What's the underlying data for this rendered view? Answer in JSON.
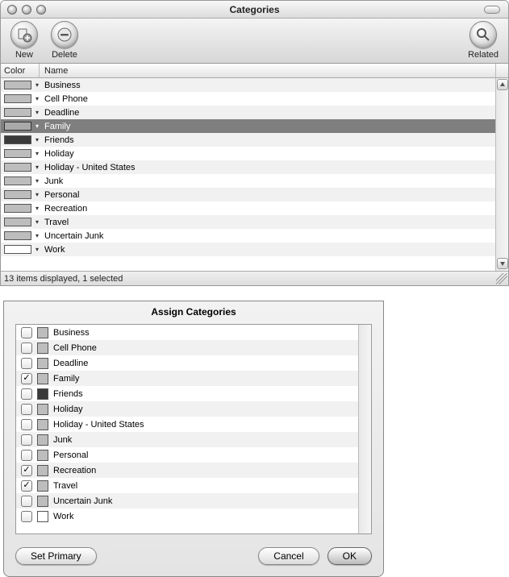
{
  "window": {
    "title": "Categories",
    "toolbar": {
      "new_label": "New",
      "delete_label": "Delete",
      "related_label": "Related"
    },
    "columns": {
      "color": "Color",
      "name": "Name"
    },
    "status": "13 items displayed, 1 selected",
    "categories": [
      {
        "name": "Business",
        "swatch": "mid",
        "selected": false
      },
      {
        "name": "Cell Phone",
        "swatch": "mid",
        "selected": false
      },
      {
        "name": "Deadline",
        "swatch": "mid",
        "selected": false
      },
      {
        "name": "Family",
        "swatch": "mid",
        "selected": true
      },
      {
        "name": "Friends",
        "swatch": "dark",
        "selected": false
      },
      {
        "name": "Holiday",
        "swatch": "mid",
        "selected": false
      },
      {
        "name": "Holiday - United States",
        "swatch": "mid",
        "selected": false
      },
      {
        "name": "Junk",
        "swatch": "mid",
        "selected": false
      },
      {
        "name": "Personal",
        "swatch": "mid",
        "selected": false
      },
      {
        "name": "Recreation",
        "swatch": "mid",
        "selected": false
      },
      {
        "name": "Travel",
        "swatch": "mid",
        "selected": false
      },
      {
        "name": "Uncertain Junk",
        "swatch": "mid",
        "selected": false
      },
      {
        "name": "Work",
        "swatch": "outline",
        "selected": false
      }
    ]
  },
  "dialog": {
    "title": "Assign Categories",
    "set_primary_label": "Set Primary",
    "cancel_label": "Cancel",
    "ok_label": "OK",
    "items": [
      {
        "name": "Business",
        "swatch": "mid",
        "checked": false
      },
      {
        "name": "Cell Phone",
        "swatch": "mid",
        "checked": false
      },
      {
        "name": "Deadline",
        "swatch": "mid",
        "checked": false
      },
      {
        "name": "Family",
        "swatch": "mid",
        "checked": true
      },
      {
        "name": "Friends",
        "swatch": "dark",
        "checked": false
      },
      {
        "name": "Holiday",
        "swatch": "mid",
        "checked": false
      },
      {
        "name": "Holiday - United States",
        "swatch": "mid",
        "checked": false
      },
      {
        "name": "Junk",
        "swatch": "mid",
        "checked": false
      },
      {
        "name": "Personal",
        "swatch": "mid",
        "checked": false
      },
      {
        "name": "Recreation",
        "swatch": "mid",
        "checked": true
      },
      {
        "name": "Travel",
        "swatch": "mid",
        "checked": true
      },
      {
        "name": "Uncertain Junk",
        "swatch": "mid",
        "checked": false
      },
      {
        "name": "Work",
        "swatch": "outline",
        "checked": false
      }
    ]
  }
}
